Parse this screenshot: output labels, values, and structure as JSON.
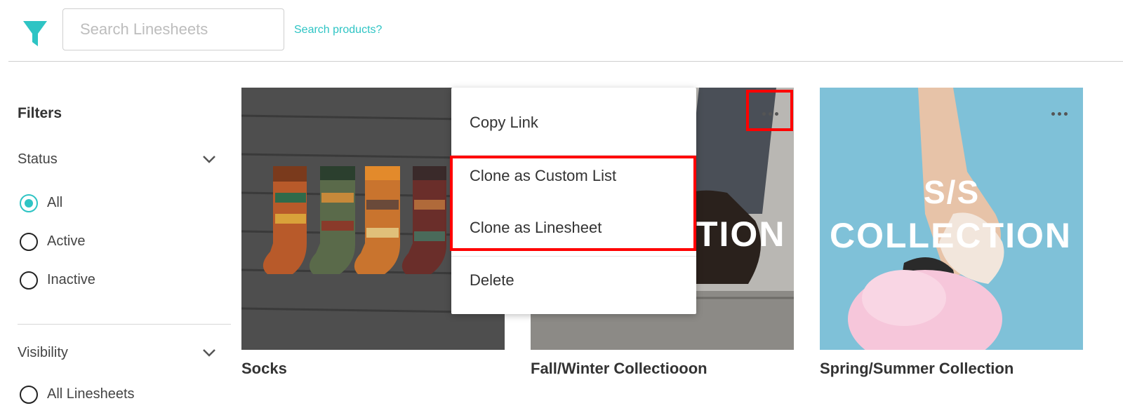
{
  "search": {
    "placeholder": "Search Linesheets",
    "products_link": "Search products?"
  },
  "colors": {
    "accent": "#2ec4c4",
    "highlight": "#ff0000"
  },
  "filters": {
    "title": "Filters",
    "status": {
      "label": "Status",
      "options": [
        "All",
        "Active",
        "Inactive"
      ],
      "selected": "All"
    },
    "visibility": {
      "label": "Visibility",
      "options": [
        "All Linesheets"
      ]
    }
  },
  "cards": [
    {
      "name": "Socks",
      "image": "socks-photo"
    },
    {
      "name": "Fall/Winter Collectiooon",
      "image": "fall-winter-photo",
      "overlay_text": [
        "TION"
      ]
    },
    {
      "name": "Spring/Summer Collection",
      "image": "spring-summer-photo",
      "overlay_text": [
        "S/S",
        "COLLECTION"
      ]
    }
  ],
  "context_menu": {
    "items": [
      "Copy Link",
      "Clone as Custom List",
      "Clone as Linesheet",
      "Delete"
    ]
  }
}
